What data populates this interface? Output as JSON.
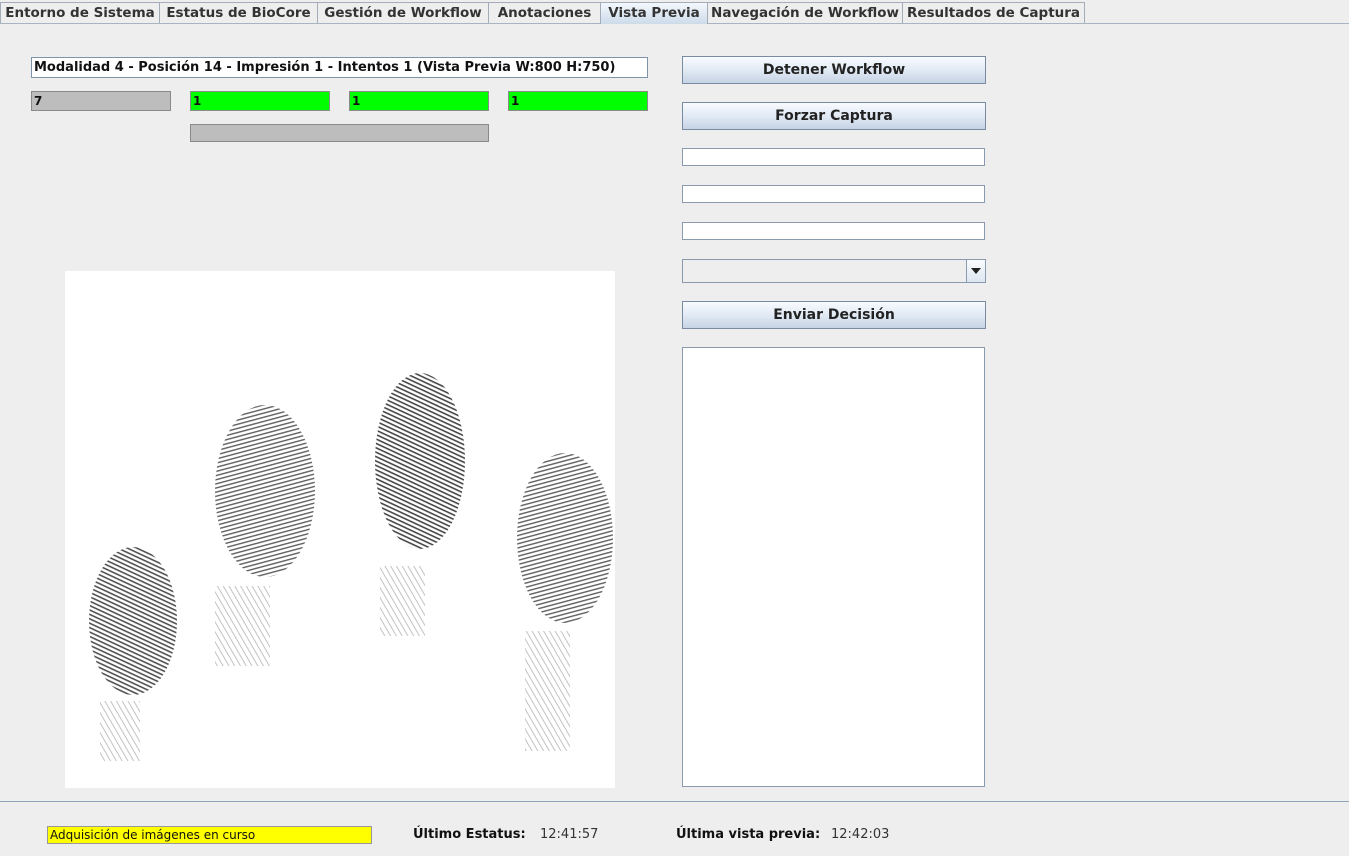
{
  "tabs": [
    {
      "label": "Entorno de Sistema",
      "active": false
    },
    {
      "label": "Estatus de BioCore",
      "active": false
    },
    {
      "label": "Gestión de Workflow",
      "active": false
    },
    {
      "label": "Anotaciones",
      "active": false
    },
    {
      "label": "Vista Previa",
      "active": true
    },
    {
      "label": "Navegación de Workflow",
      "active": false
    },
    {
      "label": "Resultados de Captura",
      "active": false
    }
  ],
  "preview": {
    "title": "Modalidad 4 - Posición 14 - Impresión 1 - Intentos 1  (Vista Previa W:800 H:750)",
    "counters": [
      {
        "value": "7",
        "color": "#bdbdbd"
      },
      {
        "value": "1",
        "color": "#00ff00"
      },
      {
        "value": "1",
        "color": "#00ff00"
      },
      {
        "value": "1",
        "color": "#00ff00"
      }
    ],
    "progress": 0,
    "image_icon": "fingerprint-slap-image"
  },
  "actions": {
    "stop_label": "Detener Workflow",
    "force_label": "Forzar Captura",
    "field1": "",
    "field2": "",
    "field3": "",
    "decision_selected": "",
    "send_label": "Enviar Decisión",
    "log_text": ""
  },
  "status": {
    "message": "Adquisición de imágenes en curso",
    "message_color": "#ffff00",
    "last_status_label": "Último Estatus:",
    "last_status_time": "12:41:57",
    "last_preview_label": "Última vista previa:",
    "last_preview_time": "12:42:03"
  }
}
